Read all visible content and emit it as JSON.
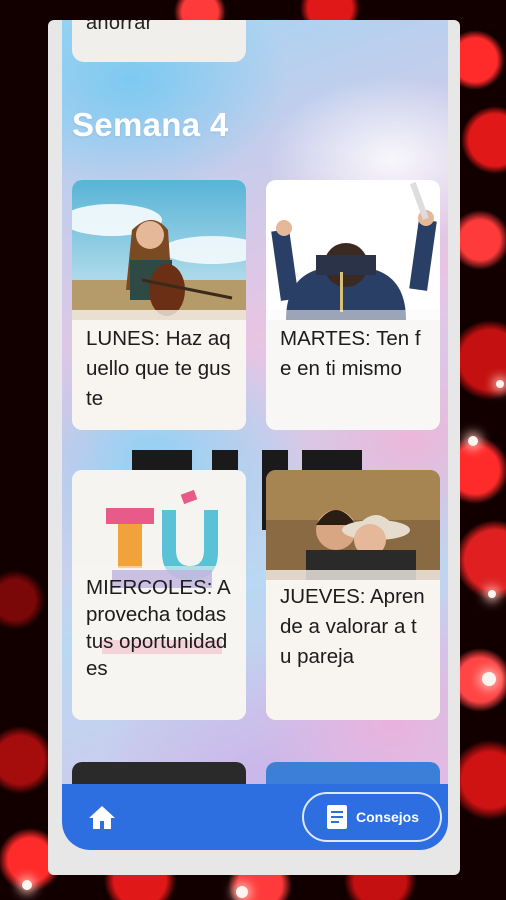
{
  "previous_card": {
    "text": "ahorrar"
  },
  "week": {
    "title": "Semana 4"
  },
  "cards": [
    {
      "label": "LUNES: Haz aquello que te guste"
    },
    {
      "label": "MARTES: Ten fe en ti mismo"
    },
    {
      "label": "MIERCOLES: Aprovecha todas tus oportunidades"
    },
    {
      "label": "JUEVES: Aprende a valorar a tu pareja"
    }
  ],
  "bottom_nav": {
    "home_icon": "home-icon",
    "tips_icon": "book-icon",
    "tips_label": "Consejos"
  },
  "colors": {
    "accent": "#2d6ee0",
    "card_bg": "#f5f3f1",
    "backdrop": "#c41010"
  }
}
